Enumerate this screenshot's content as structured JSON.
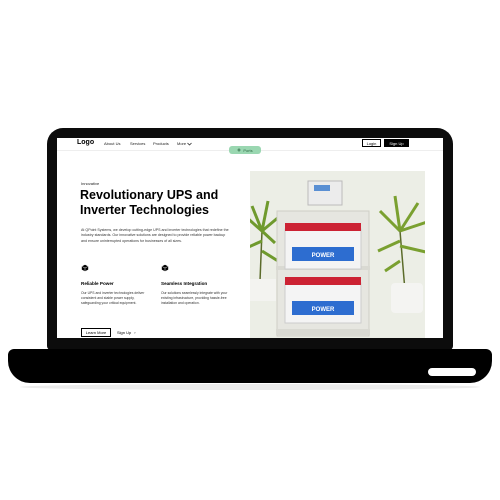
{
  "nav": {
    "logo": "Logo",
    "items": [
      "About Us",
      "Services",
      "Products",
      "More"
    ],
    "login": "Login",
    "signup": "Sign Up"
  },
  "floating_pill": "Ports",
  "hero": {
    "tagline": "Innovative",
    "title": "Revolutionary UPS and Inverter Technologies",
    "description": "At QPoint Systems, we develop cutting-edge UPS and inverter technologies that redefine the industry standards. Our innovative solutions are designed to provide reliable power backup and ensure uninterrupted operations for businesses of all sizes."
  },
  "features": [
    {
      "title": "Reliable Power",
      "desc": "Our UPS and inverter technologies deliver consistent and stable power supply, safeguarding your critical equipment."
    },
    {
      "title": "Seamless Integration",
      "desc": "Our solutions seamlessly integrate with your existing infrastructure, providing hassle-free installation and operation."
    }
  ],
  "buttons": {
    "learn_more": "Learn More",
    "sign_up": "Sign Up",
    "arrow": "›"
  },
  "image": {
    "battery_brand": "POWER"
  }
}
